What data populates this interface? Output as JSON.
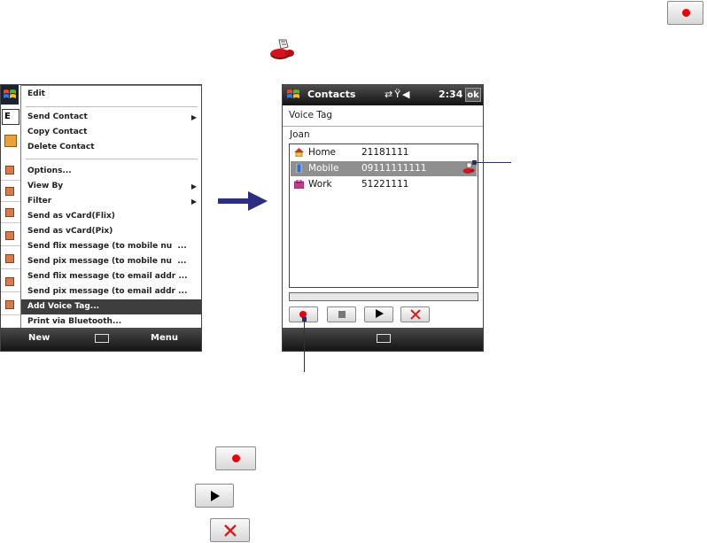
{
  "left_screen": {
    "menu_items": [
      {
        "label": "Edit",
        "submenu": false
      },
      {
        "label": "Send Contact",
        "submenu": true
      },
      {
        "label": "Copy Contact",
        "submenu": false
      },
      {
        "label": "Delete Contact",
        "submenu": false
      },
      {
        "label": "Options...",
        "submenu": false
      },
      {
        "label": "View By",
        "submenu": true
      },
      {
        "label": "Filter",
        "submenu": true
      },
      {
        "label": "Send as vCard(Flix)",
        "submenu": false
      },
      {
        "label": "Send as vCard(Pix)",
        "submenu": false
      },
      {
        "label": "Send flix message (to mobile nu  ...",
        "submenu": false
      },
      {
        "label": "Send pix message (to mobile nu  ...",
        "submenu": false
      },
      {
        "label": "Send flix message (to email addr ...",
        "submenu": false
      },
      {
        "label": "Send pix message (to email addr ...",
        "submenu": false
      },
      {
        "label": "Add Voice Tag...",
        "submenu": false,
        "selected": true
      },
      {
        "label": "Print via Bluetooth...",
        "submenu": false
      }
    ],
    "softkeys": {
      "left": "New",
      "right": "Menu"
    },
    "partial_label": "E"
  },
  "right_screen": {
    "title": "Contacts",
    "time": "2:34",
    "ok": "ok",
    "heading": "Voice Tag",
    "contact_name": "Joan",
    "entries": [
      {
        "label": "Home",
        "number": "21181111",
        "selected": false,
        "icon": "home-icon"
      },
      {
        "label": "Mobile",
        "number": "09111111111",
        "selected": true,
        "icon": "mobile-icon",
        "has_voice_tag": true
      },
      {
        "label": "Work",
        "number": "51221111",
        "selected": false,
        "icon": "work-icon"
      }
    ],
    "controls": [
      "record-icon",
      "stop-icon",
      "play-icon",
      "delete-icon"
    ]
  },
  "colors": {
    "record_red": "#e8000c",
    "delete_red": "#d42020",
    "callout_blue": "#2b2b6e",
    "arrow_blue": "#2d2d82"
  }
}
